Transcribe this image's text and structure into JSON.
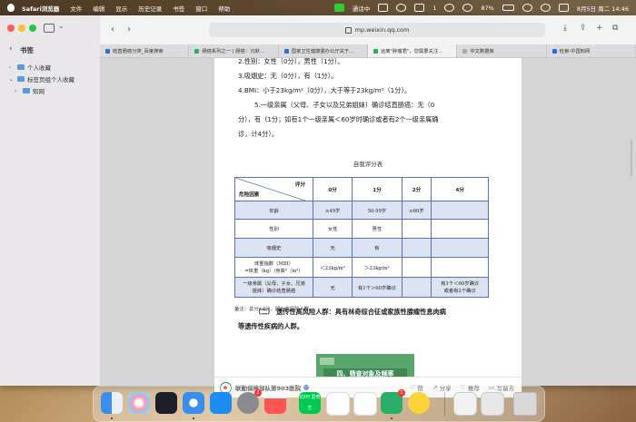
{
  "menubar": {
    "app": "Safari浏览器",
    "items": [
      "文件",
      "编辑",
      "显示",
      "历史记录",
      "书签",
      "窗口",
      "帮助"
    ],
    "phone_status": "通话中",
    "wechat_count": "1",
    "battery": "87%",
    "datetime": "8月5日 周二 14:46"
  },
  "sidebar": {
    "title": "书签",
    "items": [
      {
        "label": "个人收藏"
      },
      {
        "label": "标签页组个人收藏"
      },
      {
        "label": "知网"
      }
    ]
  },
  "toolbar": {
    "url": "mp.weixin.qq.com"
  },
  "tabs": [
    {
      "label": "结直肠癌分类_百度搜索"
    },
    {
      "label": "肠癌系列之一 | 肠癌：沉默..."
    },
    {
      "label": "国家卫生健康委办公厅关于..."
    },
    {
      "label": "远离\"肿瘤君\"，您需要关注..."
    },
    {
      "label": "中文数据库"
    },
    {
      "label": "检索-中国知网"
    }
  ],
  "article": {
    "line1": "2.性别：女性（0分），男性（1分）。",
    "line2": "3.吸烟史：无（0分），有（1分）。",
    "line3": "4.BMI：小于23kg/m²（0分），大于等于23kg/m²（1分）。",
    "line4a": "5.一级亲属（父母、子女以及兄弟姐妹）确诊结直肠癌：无（0",
    "line4b": "分），有（1分；如有1个一级亲属＜60岁时确诊或者有2个一级亲属确",
    "line4c": "诊，计4分）。",
    "table_caption": "自我评分表",
    "table": {
      "corner_top": "评分",
      "corner_bottom": "危险因素",
      "headers": [
        "0分",
        "1分",
        "2分",
        "4分"
      ],
      "rows": [
        {
          "factor": "年龄",
          "c0": "≤49岁",
          "c1": "50-59岁",
          "c2": "≥60岁",
          "c4": ""
        },
        {
          "factor": "性别",
          "c0": "女性",
          "c1": "男性",
          "c2": "",
          "c4": ""
        },
        {
          "factor": "吸烟史",
          "c0": "无",
          "c1": "有",
          "c2": "",
          "c4": ""
        },
        {
          "factor": "体重指数（MBI）\n=体重（kg）/身高²（m²）",
          "c0": "＜23kg/m²",
          "c1": "＞23kg/m²",
          "c2": "",
          "c4": ""
        },
        {
          "factor": "一级亲属（父母、子女、兄弟\n姐妹）确诊结直肠癌",
          "c0": "无",
          "c1": "有1个＞60岁确诊",
          "c2": "",
          "c4": "有1个＜60岁确诊\n或者有2个确诊"
        }
      ]
    },
    "note": "备注：总分≥4分，即为高风险人群。",
    "para2a": "（二） 遗传性高风险人群：具有林奇综合征或家族性腺瘤性息肉病",
    "para2b": "等遗传性疾病的人群。",
    "banner": "四、筛查对象及频率"
  },
  "footer": {
    "account": "联勤保障部队第903医院",
    "like": "赞",
    "share": "分享",
    "recommend": "推荐",
    "comment": "写留言"
  },
  "dock": {
    "badges": {
      "settings": "2",
      "wechat": "1"
    },
    "iqiyi_label": "iQIYI 爱奇艺"
  }
}
